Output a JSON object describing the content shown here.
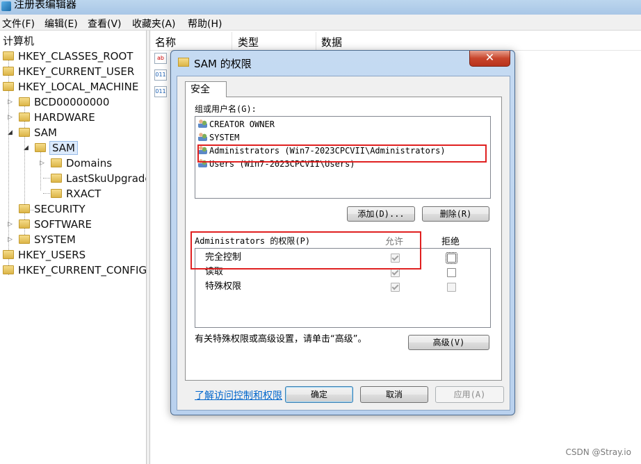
{
  "regedit": {
    "title": "注册表编辑器",
    "menu": [
      "文件(F)",
      "编辑(E)",
      "查看(V)",
      "收藏夹(A)",
      "帮助(H)"
    ],
    "tree": {
      "root": "计算机",
      "hkcr": "HKEY_CLASSES_ROOT",
      "hkcu": "HKEY_CURRENT_USER",
      "hklm": "HKEY_LOCAL_MACHINE",
      "bcd": "BCD00000000",
      "hardware": "HARDWARE",
      "sam": "SAM",
      "sam_sub": "SAM",
      "domains": "Domains",
      "lastsku": "LastSkuUpgrade",
      "rxact": "RXACT",
      "security": "SECURITY",
      "software": "SOFTWARE",
      "system": "SYSTEM",
      "hku": "HKEY_USERS",
      "hkcc": "HKEY_CURRENT_CONFIG"
    },
    "columns": [
      "名称",
      "类型",
      "数据"
    ]
  },
  "dialog": {
    "title": "SAM 的权限",
    "close": "✕",
    "tab": "安全",
    "groups_label": "组或用户名(G):",
    "groups": [
      "CREATOR OWNER",
      "SYSTEM",
      "Administrators (Win7-2023CPCVII\\Administrators)",
      "Users (Win7-2023CPCVII\\Users)"
    ],
    "add_button": "添加(D)...",
    "remove_button": "删除(R)",
    "perm_label": "Administrators 的权限(P)",
    "allow_header": "允许",
    "deny_header": "拒绝",
    "permissions": [
      {
        "name": "完全控制",
        "allow": true,
        "deny": false
      },
      {
        "name": "读取",
        "allow": true,
        "deny": false
      },
      {
        "name": "特殊权限",
        "allow": true,
        "deny": false
      }
    ],
    "advanced_text": "有关特殊权限或高级设置，请单击“高级”。",
    "advanced_button": "高级(V)",
    "help_link": "了解访问控制和权限",
    "ok_button": "确定",
    "cancel_button": "取消",
    "apply_button": "应用(A)"
  },
  "watermark": "CSDN @Stray.io",
  "colors": {
    "highlight_box": "#e02020",
    "link": "#0066cc",
    "dialog_frame": "#b9d1ee"
  }
}
